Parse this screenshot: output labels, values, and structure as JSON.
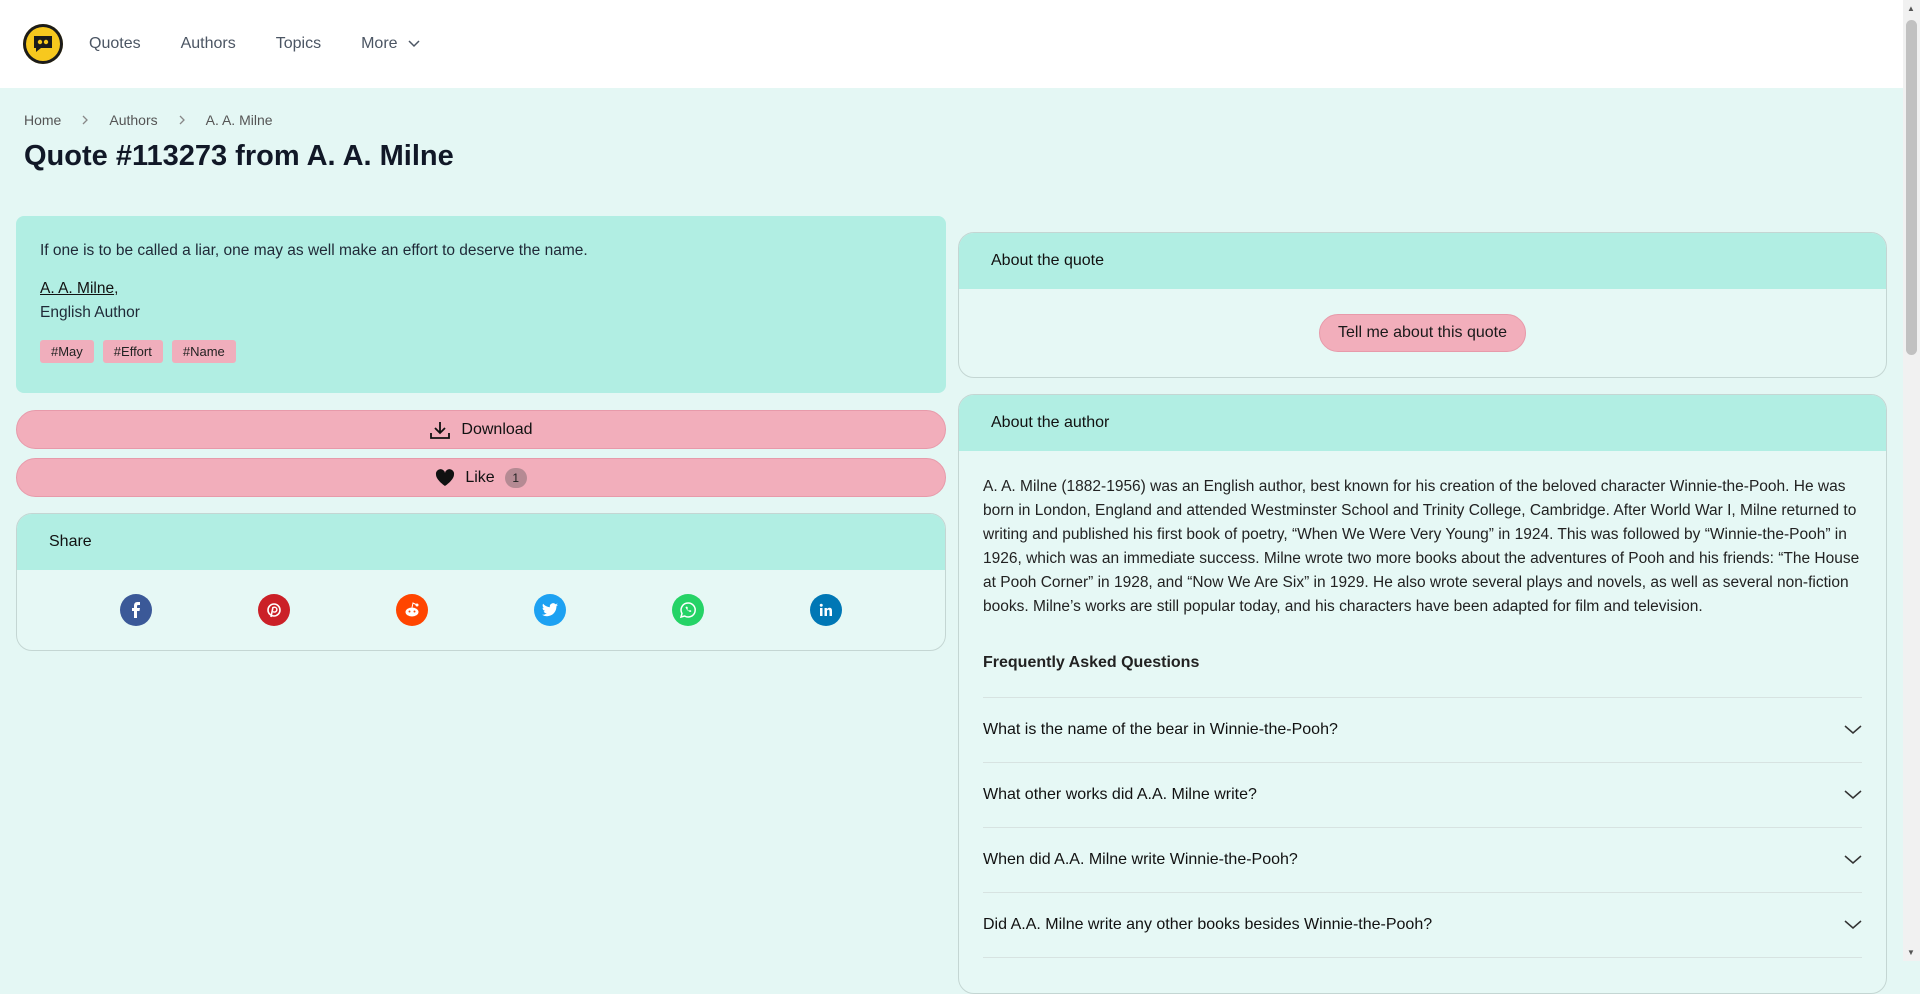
{
  "nav": {
    "logo_icon": "quote-bubble-icon",
    "items": [
      {
        "label": "Quotes"
      },
      {
        "label": "Authors"
      },
      {
        "label": "Topics"
      },
      {
        "label": "More"
      }
    ]
  },
  "breadcrumb": [
    "Home",
    "Authors",
    "A. A. Milne"
  ],
  "page_title": "Quote #113273 from A. A. Milne",
  "quote": {
    "text": "If one is to be called a liar, one may as well make an effort to deserve the name.",
    "author": "A. A. Milne",
    "author_desc": "English Author",
    "tags": [
      "#May",
      "#Effort",
      "#Name"
    ]
  },
  "actions": {
    "download_label": "Download",
    "like_label": "Like",
    "like_count": "1"
  },
  "share": {
    "title": "Share",
    "networks": [
      {
        "name": "facebook",
        "icon": "facebook-icon",
        "color": "#3b5998"
      },
      {
        "name": "pinterest",
        "icon": "pinterest-icon",
        "color": "#cb2027"
      },
      {
        "name": "reddit",
        "icon": "reddit-icon",
        "color": "#ff4500"
      },
      {
        "name": "twitter",
        "icon": "twitter-icon",
        "color": "#1da1f2"
      },
      {
        "name": "whatsapp",
        "icon": "whatsapp-icon",
        "color": "#25d366"
      },
      {
        "name": "linkedin",
        "icon": "linkedin-icon",
        "color": "#0077b5"
      }
    ]
  },
  "about_quote": {
    "title": "About the quote",
    "button_label": "Tell me about this quote"
  },
  "about_author": {
    "title": "About the author",
    "bio": "A. A. Milne (1882-1956) was an English author, best known for his creation of the beloved character Winnie-the-Pooh. He was born in London, England and attended Westminster School and Trinity College, Cambridge. After World War I, Milne returned to writing and published his first book of poetry, “When We Were Very Young” in 1924. This was followed by “Winnie-the-Pooh” in 1926, which was an immediate success. Milne wrote two more books about the adventures of Pooh and his friends: “The House at Pooh Corner” in 1928, and “Now We Are Six” in 1929. He also wrote several plays and novels, as well as several non-fiction books. Milne’s works are still popular today, and his characters have been adapted for film and television.",
    "faq_title": "Frequently Asked Questions",
    "faq": [
      "What is the name of the bear in Winnie-the-Pooh?",
      "What other works did A.A. Milne write?",
      "When did A.A. Milne write Winnie-the-Pooh?",
      "Did A.A. Milne write any other books besides Winnie-the-Pooh?"
    ]
  },
  "colors": {
    "page_bg": "#e4f7f4",
    "accent_teal": "#b1eee3",
    "accent_pink": "#f2aebb",
    "logo_yellow": "#f7c81e"
  }
}
